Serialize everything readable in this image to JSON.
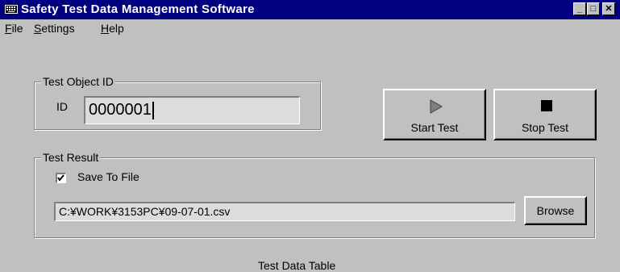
{
  "window": {
    "title": "Safety Test Data Management Software",
    "icon": "keyboard-icon",
    "controls": [
      "minimize",
      "maximize",
      "close"
    ],
    "minimize_glyph": "_",
    "maximize_glyph": "□",
    "close_glyph": "✕"
  },
  "menu": {
    "file": {
      "mnemonic": "F",
      "rest": "ile"
    },
    "settings": {
      "mnemonic": "S",
      "rest": "ettings"
    },
    "help": {
      "mnemonic": "H",
      "rest": "elp"
    }
  },
  "test_object": {
    "group_label": "Test Object ID",
    "id_label": "ID",
    "id_value": "0000001"
  },
  "buttons": {
    "start": "Start Test",
    "stop": "Stop Test",
    "browse": "Browse"
  },
  "test_result": {
    "group_label": "Test Result",
    "save_to_file_label": "Save To File",
    "save_to_file_checked": true,
    "file_path": "C:¥WORK¥3153PC¥09-07-01.csv"
  },
  "table": {
    "title": "Test Data Table"
  }
}
